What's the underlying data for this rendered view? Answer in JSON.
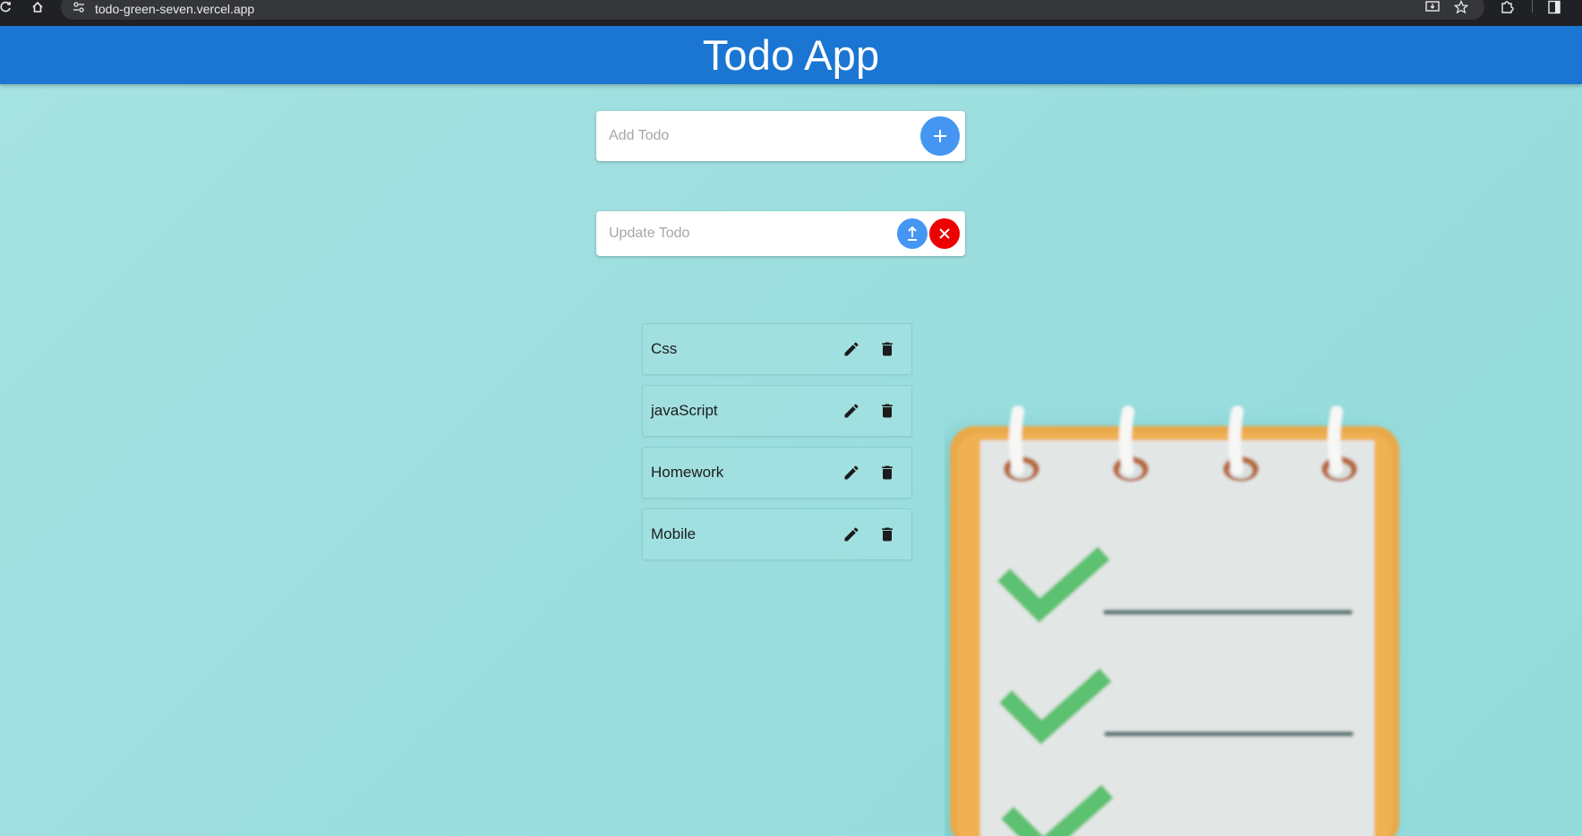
{
  "browser": {
    "url": "todo-green-seven.vercel.app"
  },
  "app": {
    "title": "Todo App"
  },
  "add_form": {
    "placeholder": "Add Todo",
    "value": "",
    "button_color": "#4596f3"
  },
  "update_form": {
    "placeholder": "Update Todo",
    "value": "",
    "update_button_color": "#4596f3",
    "cancel_button_color": "#ee0000"
  },
  "todos": [
    {
      "label": "Css"
    },
    {
      "label": "javaScript"
    },
    {
      "label": "Homework"
    },
    {
      "label": "Mobile"
    }
  ],
  "colors": {
    "header": "#1a76d2",
    "background": "#9ddede"
  },
  "icons": {
    "add": "plus-icon",
    "update": "upload-icon",
    "cancel": "close-icon",
    "edit": "pencil-icon",
    "delete": "trash-icon"
  }
}
